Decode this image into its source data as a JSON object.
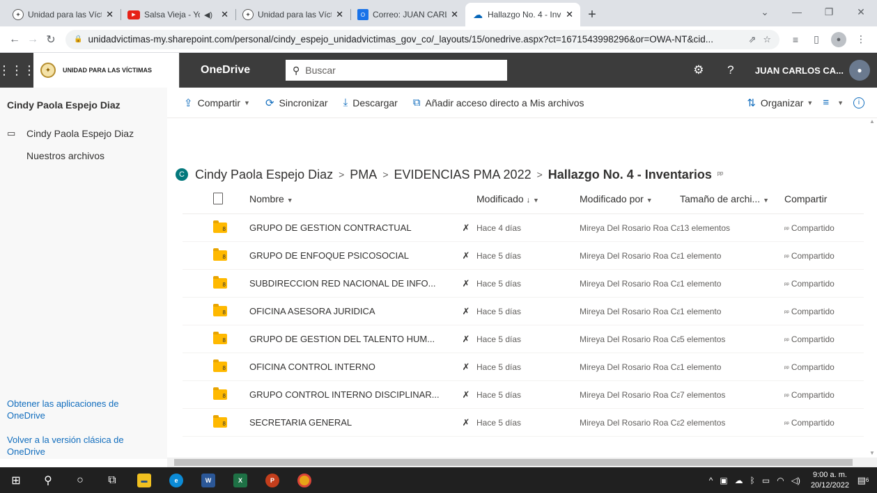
{
  "browser": {
    "tabs": [
      {
        "title": "Unidad para las Víctimas |",
        "icon": "seal",
        "active": false
      },
      {
        "title": "Salsa Vieja - YouTube",
        "icon": "youtube",
        "active": false,
        "audio": true
      },
      {
        "title": "Unidad para las Víctimas |",
        "icon": "seal",
        "active": false
      },
      {
        "title": "Correo: JUAN CARLOS CA",
        "icon": "outlook",
        "active": false
      },
      {
        "title": "Hallazgo No. 4 - Inventari",
        "icon": "onedrive",
        "active": true
      }
    ],
    "url": "unidadvictimas-my.sharepoint.com/personal/cindy_espejo_unidadvictimas_gov_co/_layouts/15/onedrive.aspx?ct=1671543998296&or=OWA-NT&cid..."
  },
  "suite": {
    "org_name": "UNIDAD PARA LAS VÍCTIMAS",
    "app_name": "OneDrive",
    "search_placeholder": "Buscar",
    "user_name": "JUAN CARLOS CA..."
  },
  "leftnav": {
    "owner": "Cindy Paola Espejo Diaz",
    "items": [
      "Cindy Paola Espejo Diaz",
      "Nuestros archivos"
    ],
    "get_apps": "Obtener las aplicaciones de OneDrive",
    "classic": "Volver a la versión clásica de OneDrive"
  },
  "commands": {
    "share": "Compartir",
    "sync": "Sincronizar",
    "download": "Descargar",
    "shortcut": "Añadir acceso directo a Mis archivos",
    "sort": "Organizar"
  },
  "breadcrumb": {
    "site_initial": "C",
    "parts": [
      "Cindy Paola Espejo Diaz",
      "PMA",
      "EVIDENCIAS PMA 2022"
    ],
    "current": "Hallazgo No. 4 - Inventarios"
  },
  "columns": {
    "name": "Nombre",
    "modified": "Modificado",
    "modified_by": "Modificado por",
    "size": "Tamaño de archi...",
    "sharing": "Compartir"
  },
  "files": [
    {
      "name": "GRUPO DE GESTION CONTRACTUAL",
      "modified": "Hace 4 días",
      "by": "Mireya Del Rosario Roa Ca",
      "size": "13 elementos",
      "sharing": "Compartido"
    },
    {
      "name": "GRUPO DE ENFOQUE PSICOSOCIAL",
      "modified": "Hace 5 días",
      "by": "Mireya Del Rosario Roa Ca",
      "size": "1 elemento",
      "sharing": "Compartido"
    },
    {
      "name": "SUBDIRECCION RED NACIONAL DE INFO...",
      "modified": "Hace 5 días",
      "by": "Mireya Del Rosario Roa Ca",
      "size": "1 elemento",
      "sharing": "Compartido"
    },
    {
      "name": "OFICINA ASESORA JURIDICA",
      "modified": "Hace 5 días",
      "by": "Mireya Del Rosario Roa Ca",
      "size": "1 elemento",
      "sharing": "Compartido"
    },
    {
      "name": "GRUPO DE GESTION DEL TALENTO HUM...",
      "modified": "Hace 5 días",
      "by": "Mireya Del Rosario Roa Ca",
      "size": "5 elementos",
      "sharing": "Compartido"
    },
    {
      "name": "OFICINA CONTROL INTERNO",
      "modified": "Hace 5 días",
      "by": "Mireya Del Rosario Roa Ca",
      "size": "1 elemento",
      "sharing": "Compartido"
    },
    {
      "name": "GRUPO CONTROL INTERNO DISCIPLINAR...",
      "modified": "Hace 5 días",
      "by": "Mireya Del Rosario Roa Ca",
      "size": "7 elementos",
      "sharing": "Compartido"
    },
    {
      "name": "SECRETARIA GENERAL",
      "modified": "Hace 5 días",
      "by": "Mireya Del Rosario Roa Ca",
      "size": "2 elementos",
      "sharing": "Compartido"
    }
  ],
  "taskbar": {
    "time": "9:00 a. m.",
    "date": "20/12/2022",
    "notifications": "6"
  }
}
